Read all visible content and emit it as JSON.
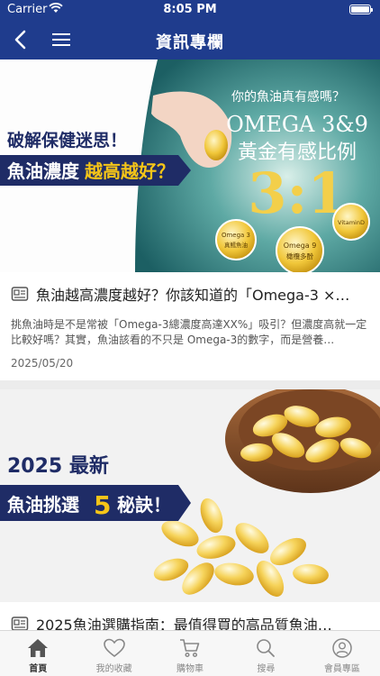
{
  "status": {
    "carrier": "Carrier",
    "time": "8:05 PM"
  },
  "nav": {
    "title": "資訊專欄"
  },
  "articles": [
    {
      "title": "魚油越高濃度越好？你該知道的「Omega-3 ×…",
      "desc": "挑魚油時是不是常被「Omega-3總濃度高達XX%」吸引？但濃度高就一定比較好嗎？其實，魚油該看的不只是 Omega-3的數字，而是營養…",
      "date": "2025/05/20",
      "banner": {
        "tag": "破解保健迷思！",
        "headline_a": "魚油濃度",
        "headline_b": "越高越好？",
        "q": "你的魚油真有感嗎？",
        "omega": "OMEGA 3&9",
        "ratio_text": "黃金有感比例",
        "ratio": "3:1",
        "badge1_a": "Omega 3",
        "badge1_b": "真鱈魚油",
        "badge2_a": "Omega 9",
        "badge2_b": "橄欖多酚",
        "badge3": "VitaminD"
      }
    },
    {
      "title": "2025魚油選購指南：最值得買的高品質魚油…",
      "banner": {
        "line1": "2025 最新",
        "line2a": "魚油挑選",
        "line2num": "5",
        "line2b": "秘訣！"
      }
    }
  ],
  "tabs": [
    {
      "label": "首頁",
      "icon": "home-icon",
      "active": true
    },
    {
      "label": "我的收藏",
      "icon": "heart-icon",
      "active": false
    },
    {
      "label": "購物車",
      "icon": "cart-icon",
      "active": false
    },
    {
      "label": "搜尋",
      "icon": "search-icon",
      "active": false
    },
    {
      "label": "會員專區",
      "icon": "user-icon",
      "active": false
    }
  ],
  "colors": {
    "brand": "#1f3c8d",
    "accent": "#f5c518",
    "teal": "#1a6f70"
  }
}
